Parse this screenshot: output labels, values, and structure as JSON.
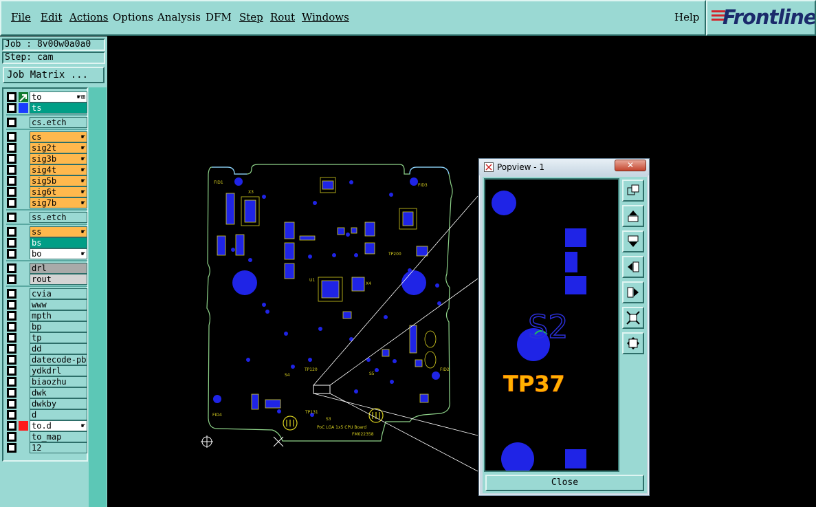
{
  "menu": {
    "file": "File",
    "edit": "Edit",
    "actions": "Actions",
    "options": "Options",
    "analysis": "Analysis",
    "dfm": "DFM",
    "step": "Step",
    "rout": "Rout",
    "windows": "Windows",
    "help": "Help"
  },
  "brand": {
    "name": "Frontline"
  },
  "job": {
    "label": "Job : 8v00w0a0a0"
  },
  "step": {
    "label": "Step: cam"
  },
  "job_matrix": {
    "label": "Job Matrix ..."
  },
  "layers": {
    "to": "to",
    "ts": "ts",
    "cs_etch": "cs.etch",
    "cs": "cs",
    "sig2t": "sig2t",
    "sig3b": "sig3b",
    "sig4t": "sig4t",
    "sig5b": "sig5b",
    "sig6t": "sig6t",
    "sig7b": "sig7b",
    "ss_etch": "ss.etch",
    "ss": "ss",
    "bs": "bs",
    "bo": "bo",
    "drl": "drl",
    "rout": "rout",
    "cvia": "cvia",
    "www": "www",
    "mpth": "mpth",
    "bp": "bp",
    "tp": "tp",
    "dd": "dd",
    "datecode": "datecode-pb",
    "ydkdrl": "ydkdrl",
    "biaozhu": "biaozhu",
    "dwk": "dwk",
    "dwkby": "dwkby",
    "d": "d",
    "to_d": "to.d",
    "to_map": "to_map",
    "n12": "12"
  },
  "colors": {
    "panel": "#9ad9d3",
    "orange": "#ffb84d",
    "teal": "#009e86",
    "grey": "#a9aaa9",
    "light_grey": "#d4d4d4",
    "white": "#ffffff",
    "copper": "#1f24e6",
    "silk": "#d8d020",
    "outline": "#88ccff"
  },
  "board": {
    "labels": {
      "fid1": "FID1",
      "fid2": "FID2",
      "fid3": "FID3",
      "fid4": "FID4",
      "u1": "U1",
      "x3": "X3",
      "x4": "X4",
      "s3": "S3",
      "s4": "S4",
      "s5": "S5",
      "tp120": "TP120",
      "tp131": "TP131",
      "tp200": "TP200",
      "board_title": "PoC LGA 1x5 CPU Board",
      "board_id": "FM022358"
    }
  },
  "popview": {
    "title": "Popview - 1",
    "designator": "S2",
    "testpoint": "TP37",
    "close": "Close"
  }
}
